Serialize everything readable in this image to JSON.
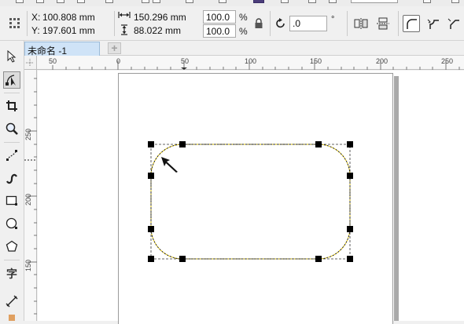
{
  "window": {
    "document_tab": "未命名 -1",
    "new_tab_symbol": "+"
  },
  "property_bar": {
    "x_label": "X:",
    "x_value": "100.808 mm",
    "y_label": "Y:",
    "y_value": "197.601 mm",
    "width_value": "150.296 mm",
    "height_value": "88.022 mm",
    "scale_x": "100.0",
    "scale_y": "100.0",
    "percent_symbol": "%",
    "rotation_value": ".0",
    "degree_symbol": "°"
  },
  "rulers": {
    "horizontal": [
      "50",
      "0",
      "50",
      "100",
      "150",
      "200",
      "250"
    ],
    "vertical": [
      "250",
      "200",
      "150"
    ]
  },
  "colors": {
    "selection_outline": "#e6c800",
    "document_tab_bg": "#cfe3f7",
    "page_shadow": "#a9a9a9"
  },
  "icons": {
    "toolbox": [
      "pick-tool-icon",
      "shape-tool-icon",
      "crop-tool-icon",
      "zoom-tool-icon",
      "freehand-tool-icon",
      "artistic-media-icon",
      "rectangle-tool-icon",
      "ellipse-tool-icon",
      "polygon-tool-icon",
      "text-tool-icon",
      "parallel-dimension-icon"
    ],
    "property_bar": [
      "grip-icon",
      "width-arrows-icon",
      "height-arrows-icon",
      "lock-ratio-icon",
      "rotate-icon",
      "mirror-horizontal-icon",
      "mirror-vertical-icon",
      "round-corner-icon",
      "scalloped-corner-icon",
      "chamfered-corner-icon"
    ]
  }
}
